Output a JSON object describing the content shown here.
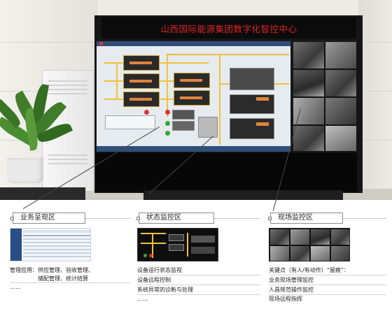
{
  "wall": {
    "title": "山西国际能源集团数字化智控中心"
  },
  "zones": [
    {
      "label": "业务呈现区",
      "items": [
        "管理应用：供应管理、验收管理、",
        "储配管理、统计结算",
        "……"
      ]
    },
    {
      "label": "状态监控区",
      "items": [
        "设备运行状态监视",
        "设备远程控制",
        "系统异常的诊断与处理",
        "……"
      ]
    },
    {
      "label": "现场监控区",
      "items": [
        "关键点（有人/有动作）“留痕”：",
        "业务现场管理监控",
        "人昌规范操作监控",
        "现场远程指挥"
      ]
    }
  ]
}
